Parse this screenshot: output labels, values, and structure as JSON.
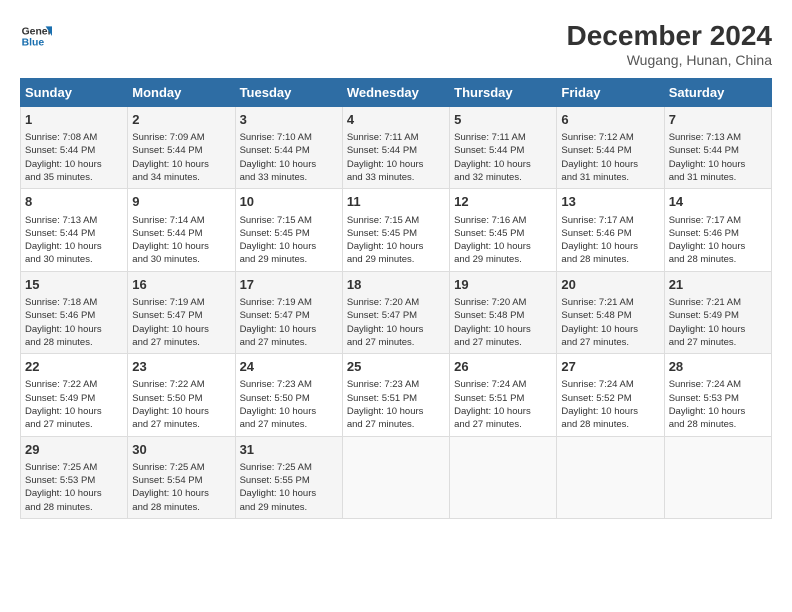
{
  "header": {
    "logo_line1": "General",
    "logo_line2": "Blue",
    "title": "December 2024",
    "subtitle": "Wugang, Hunan, China"
  },
  "days_of_week": [
    "Sunday",
    "Monday",
    "Tuesday",
    "Wednesday",
    "Thursday",
    "Friday",
    "Saturday"
  ],
  "weeks": [
    [
      {
        "day": 1,
        "lines": [
          "Sunrise: 7:08 AM",
          "Sunset: 5:44 PM",
          "Daylight: 10 hours",
          "and 35 minutes."
        ]
      },
      {
        "day": 2,
        "lines": [
          "Sunrise: 7:09 AM",
          "Sunset: 5:44 PM",
          "Daylight: 10 hours",
          "and 34 minutes."
        ]
      },
      {
        "day": 3,
        "lines": [
          "Sunrise: 7:10 AM",
          "Sunset: 5:44 PM",
          "Daylight: 10 hours",
          "and 33 minutes."
        ]
      },
      {
        "day": 4,
        "lines": [
          "Sunrise: 7:11 AM",
          "Sunset: 5:44 PM",
          "Daylight: 10 hours",
          "and 33 minutes."
        ]
      },
      {
        "day": 5,
        "lines": [
          "Sunrise: 7:11 AM",
          "Sunset: 5:44 PM",
          "Daylight: 10 hours",
          "and 32 minutes."
        ]
      },
      {
        "day": 6,
        "lines": [
          "Sunrise: 7:12 AM",
          "Sunset: 5:44 PM",
          "Daylight: 10 hours",
          "and 31 minutes."
        ]
      },
      {
        "day": 7,
        "lines": [
          "Sunrise: 7:13 AM",
          "Sunset: 5:44 PM",
          "Daylight: 10 hours",
          "and 31 minutes."
        ]
      }
    ],
    [
      {
        "day": 8,
        "lines": [
          "Sunrise: 7:13 AM",
          "Sunset: 5:44 PM",
          "Daylight: 10 hours",
          "and 30 minutes."
        ]
      },
      {
        "day": 9,
        "lines": [
          "Sunrise: 7:14 AM",
          "Sunset: 5:44 PM",
          "Daylight: 10 hours",
          "and 30 minutes."
        ]
      },
      {
        "day": 10,
        "lines": [
          "Sunrise: 7:15 AM",
          "Sunset: 5:45 PM",
          "Daylight: 10 hours",
          "and 29 minutes."
        ]
      },
      {
        "day": 11,
        "lines": [
          "Sunrise: 7:15 AM",
          "Sunset: 5:45 PM",
          "Daylight: 10 hours",
          "and 29 minutes."
        ]
      },
      {
        "day": 12,
        "lines": [
          "Sunrise: 7:16 AM",
          "Sunset: 5:45 PM",
          "Daylight: 10 hours",
          "and 29 minutes."
        ]
      },
      {
        "day": 13,
        "lines": [
          "Sunrise: 7:17 AM",
          "Sunset: 5:46 PM",
          "Daylight: 10 hours",
          "and 28 minutes."
        ]
      },
      {
        "day": 14,
        "lines": [
          "Sunrise: 7:17 AM",
          "Sunset: 5:46 PM",
          "Daylight: 10 hours",
          "and 28 minutes."
        ]
      }
    ],
    [
      {
        "day": 15,
        "lines": [
          "Sunrise: 7:18 AM",
          "Sunset: 5:46 PM",
          "Daylight: 10 hours",
          "and 28 minutes."
        ]
      },
      {
        "day": 16,
        "lines": [
          "Sunrise: 7:19 AM",
          "Sunset: 5:47 PM",
          "Daylight: 10 hours",
          "and 27 minutes."
        ]
      },
      {
        "day": 17,
        "lines": [
          "Sunrise: 7:19 AM",
          "Sunset: 5:47 PM",
          "Daylight: 10 hours",
          "and 27 minutes."
        ]
      },
      {
        "day": 18,
        "lines": [
          "Sunrise: 7:20 AM",
          "Sunset: 5:47 PM",
          "Daylight: 10 hours",
          "and 27 minutes."
        ]
      },
      {
        "day": 19,
        "lines": [
          "Sunrise: 7:20 AM",
          "Sunset: 5:48 PM",
          "Daylight: 10 hours",
          "and 27 minutes."
        ]
      },
      {
        "day": 20,
        "lines": [
          "Sunrise: 7:21 AM",
          "Sunset: 5:48 PM",
          "Daylight: 10 hours",
          "and 27 minutes."
        ]
      },
      {
        "day": 21,
        "lines": [
          "Sunrise: 7:21 AM",
          "Sunset: 5:49 PM",
          "Daylight: 10 hours",
          "and 27 minutes."
        ]
      }
    ],
    [
      {
        "day": 22,
        "lines": [
          "Sunrise: 7:22 AM",
          "Sunset: 5:49 PM",
          "Daylight: 10 hours",
          "and 27 minutes."
        ]
      },
      {
        "day": 23,
        "lines": [
          "Sunrise: 7:22 AM",
          "Sunset: 5:50 PM",
          "Daylight: 10 hours",
          "and 27 minutes."
        ]
      },
      {
        "day": 24,
        "lines": [
          "Sunrise: 7:23 AM",
          "Sunset: 5:50 PM",
          "Daylight: 10 hours",
          "and 27 minutes."
        ]
      },
      {
        "day": 25,
        "lines": [
          "Sunrise: 7:23 AM",
          "Sunset: 5:51 PM",
          "Daylight: 10 hours",
          "and 27 minutes."
        ]
      },
      {
        "day": 26,
        "lines": [
          "Sunrise: 7:24 AM",
          "Sunset: 5:51 PM",
          "Daylight: 10 hours",
          "and 27 minutes."
        ]
      },
      {
        "day": 27,
        "lines": [
          "Sunrise: 7:24 AM",
          "Sunset: 5:52 PM",
          "Daylight: 10 hours",
          "and 28 minutes."
        ]
      },
      {
        "day": 28,
        "lines": [
          "Sunrise: 7:24 AM",
          "Sunset: 5:53 PM",
          "Daylight: 10 hours",
          "and 28 minutes."
        ]
      }
    ],
    [
      {
        "day": 29,
        "lines": [
          "Sunrise: 7:25 AM",
          "Sunset: 5:53 PM",
          "Daylight: 10 hours",
          "and 28 minutes."
        ]
      },
      {
        "day": 30,
        "lines": [
          "Sunrise: 7:25 AM",
          "Sunset: 5:54 PM",
          "Daylight: 10 hours",
          "and 28 minutes."
        ]
      },
      {
        "day": 31,
        "lines": [
          "Sunrise: 7:25 AM",
          "Sunset: 5:55 PM",
          "Daylight: 10 hours",
          "and 29 minutes."
        ]
      },
      null,
      null,
      null,
      null
    ]
  ]
}
